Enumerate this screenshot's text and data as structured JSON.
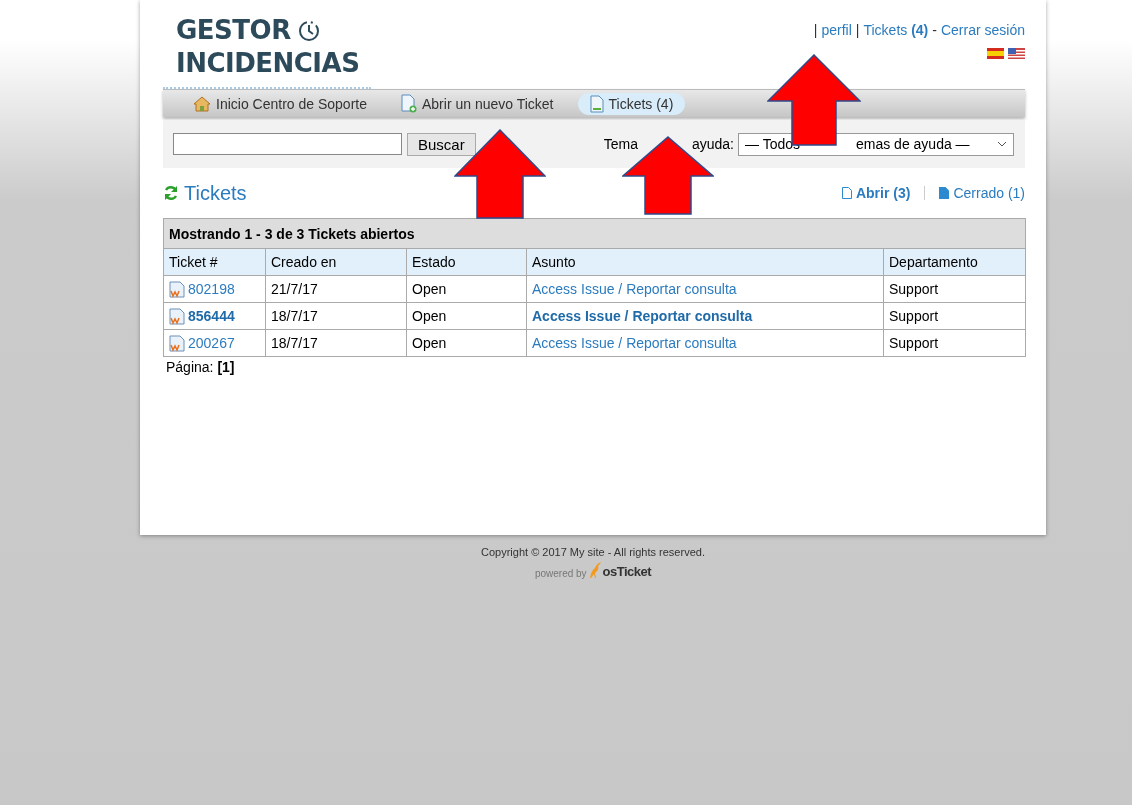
{
  "logo": {
    "line1": "GESTOR",
    "line2": "INCIDENCIAS"
  },
  "user_nav": [
    {
      "kind": "sep",
      "text": "|"
    },
    {
      "kind": "link",
      "text": "perfil"
    },
    {
      "kind": "sep",
      "text": "|"
    },
    {
      "kind": "link",
      "text": "Tickets **(4)**"
    },
    {
      "kind": "sep",
      "text": "-"
    },
    {
      "kind": "link",
      "text": "Cerrar sesión"
    }
  ],
  "nav_tabs": [
    {
      "label": "Inicio Centro de Soporte",
      "kind": "home",
      "selected": false
    },
    {
      "label": "Abrir un nuevo Ticket",
      "kind": "new",
      "selected": false
    },
    {
      "label": "Tickets (4)",
      "kind": "tickets",
      "selected": true
    }
  ],
  "search": {
    "button": "Buscar"
  },
  "help_topic": {
    "label_parts": [
      "Tema",
      "ayuda:"
    ],
    "value_parts": [
      "— Todos",
      "emas de ayuda —"
    ]
  },
  "heading": "Tickets",
  "filters": [
    {
      "label": "Abrir (3)",
      "selected": true
    },
    {
      "label": "Cerrado (1)",
      "selected": false
    }
  ],
  "table": {
    "caption": "Mostrando 1 - 3 de 3 Tickets abiertos",
    "columns": [
      "Ticket #",
      "Creado en",
      "Estado",
      "Asunto",
      "Departamento"
    ],
    "rows": [
      {
        "ticket": "802198",
        "created": "21/7/17",
        "status": "Open",
        "subject": "Access Issue / Reportar consulta",
        "department": "Support",
        "unread": false
      },
      {
        "ticket": "856444",
        "created": "18/7/17",
        "status": "Open",
        "subject": "Access Issue / Reportar consulta",
        "department": "Support",
        "unread": true
      },
      {
        "ticket": "200267",
        "created": "18/7/17",
        "status": "Open",
        "subject": "Access Issue / Reportar consulta",
        "department": "Support",
        "unread": false
      }
    ]
  },
  "pagination": {
    "label": "Página:",
    "page": "[1]"
  },
  "footer": {
    "copyright": "Copyright © 2017 My site - All rights reserved.",
    "powered_by": "powered by",
    "brand": "osTicket"
  }
}
